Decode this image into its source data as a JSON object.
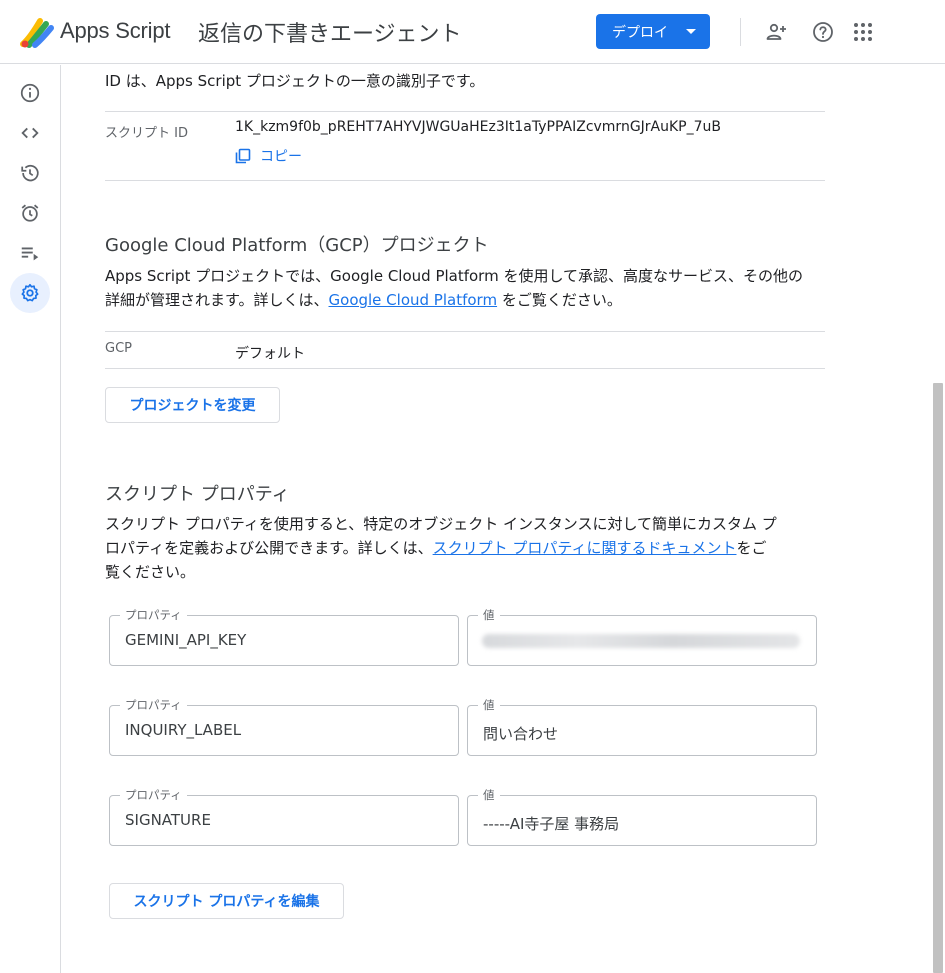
{
  "header": {
    "app_name": "Apps Script",
    "project_title": "返信の下書きエージェント",
    "deploy_label": "デプロイ",
    "icons": [
      "add-person-icon",
      "help-icon",
      "apps-grid-icon"
    ]
  },
  "rail": {
    "items": [
      {
        "name": "overview",
        "icon": "info-icon"
      },
      {
        "name": "editor",
        "icon": "code-icon"
      },
      {
        "name": "history",
        "icon": "history-icon"
      },
      {
        "name": "triggers",
        "icon": "alarm-icon"
      },
      {
        "name": "executions",
        "icon": "executions-icon"
      },
      {
        "name": "settings",
        "icon": "gear-icon",
        "active": true
      }
    ]
  },
  "ids": {
    "description": "ID は、Apps Script プロジェクトの一意の識別子です。",
    "script_id_label": "スクリプト ID",
    "script_id_value": "1K_kzm9f0b_pREHT7AHYVJWGUaHEz3It1aTyPPAIZcvmrnGJrAuKP_7uB",
    "copy_label": "コピー"
  },
  "gcp": {
    "title": "Google Cloud Platform（GCP）プロジェクト",
    "desc_before": "Apps Script プロジェクトでは、Google Cloud Platform を使用して承認、高度なサービス、その他の",
    "desc_line2_before": "詳細が管理されます。詳しくは、",
    "desc_link": "Google Cloud Platform",
    "desc_after": " をご覧ください。",
    "row_label": "GCP",
    "row_value": "デフォルト",
    "change_button": "プロジェクトを変更"
  },
  "script_properties": {
    "title": "スクリプト プロパティ",
    "desc_line1": "スクリプト プロパティを使用すると、特定のオブジェクト インスタンスに対して簡単にカスタム プ",
    "desc_line2_before": "ロパティを定義および公開できます。詳しくは、",
    "desc_link": "スクリプト プロパティに関するドキュメント",
    "desc_line2_after": "をご",
    "desc_line3": "覧ください。",
    "property_label": "プロパティ",
    "value_label": "値",
    "rows": [
      {
        "property": "GEMINI_API_KEY",
        "value": "",
        "value_blurred": true
      },
      {
        "property": "INQUIRY_LABEL",
        "value": "問い合わせ"
      },
      {
        "property": "SIGNATURE",
        "value": "-----AI寺子屋 事務局"
      }
    ],
    "edit_button": "スクリプト プロパティを編集"
  },
  "colors": {
    "accent": "#1a73e8",
    "active_rail_bg": "#e8f0fe",
    "divider": "#dadce0",
    "logo_colors": [
      "#fbbc04",
      "#34a853",
      "#4285f4",
      "#ea4335"
    ]
  }
}
